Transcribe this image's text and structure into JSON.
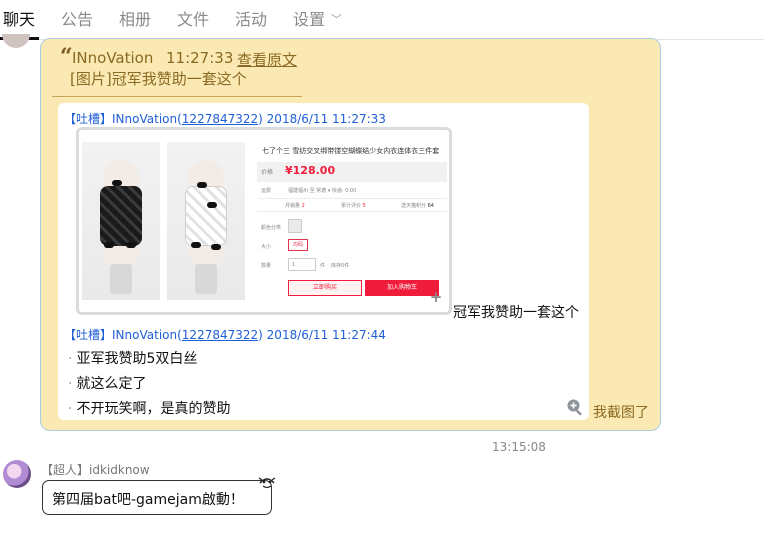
{
  "tabs": [
    {
      "label": "聊天",
      "active": true
    },
    {
      "label": "公告"
    },
    {
      "label": "相册"
    },
    {
      "label": "文件"
    },
    {
      "label": "活动"
    },
    {
      "label": "设置",
      "dropdown": true
    }
  ],
  "quote": {
    "mark": "“",
    "name": "INnoVation",
    "time": "11:27:33",
    "view_original": "查看原文",
    "text": "[图片]冠军我赞助一套这个"
  },
  "forwarded": {
    "message1": {
      "tag": "【吐槽】",
      "name": "INnoVation",
      "uid_open": "(",
      "uid": "1227847322",
      "uid_close": ")",
      "timestamp": "2018/6/11 11:27:33",
      "caption": "冠军我赞助一套这个"
    },
    "product_image": {
      "title": "七了个三 雪纺交叉绑带镂空蝴蝶结少女内衣连体衣三件套",
      "price_label": "价格",
      "price": "¥128.00",
      "shipping": "运费",
      "shipping_value": "福建福州 至 常德 ▾ 快递: 0.00",
      "monthly_sales": "月销量",
      "monthly_sales_value": "2",
      "total_reviews": "累计评价",
      "total_reviews_value": "5",
      "points": "送天猫积分",
      "points_value": "64",
      "color_label": "颜色分类",
      "size_label": "大小",
      "size_value": "均码",
      "qty_label": "数量",
      "qty_value": "1",
      "qty_unit": "件",
      "stock": "库存0件",
      "buy_now": "立即购买",
      "add_cart": "加入购物车"
    },
    "message2": {
      "tag": "【吐槽】",
      "name": "INnoVation",
      "uid_open": "(",
      "uid": "1227847322",
      "uid_close": ")",
      "timestamp": "2018/6/11 11:27:44",
      "lines": [
        "亚军我赞助5双白丝",
        "就这么定了",
        "不开玩笑啊，是真的赞助"
      ]
    }
  },
  "screenshot_link": "我截图了",
  "time_divider": "13:15:08",
  "message_new": {
    "sender_badge": "【超人】",
    "sender_name": "idkidknow",
    "text": "第四届bat吧-gamejam啟動！"
  },
  "colors": {
    "bubble_bg": "#fbe9b4",
    "bubble_border": "#a9cde3",
    "quote_text": "#8a6a22",
    "link_blue": "#1f5fd6",
    "price_red": "#f01c3c"
  },
  "icons": [
    "chevron-down-icon",
    "zoom-plus-icon",
    "magnifier-plus-icon",
    "face-decoration-icon"
  ]
}
